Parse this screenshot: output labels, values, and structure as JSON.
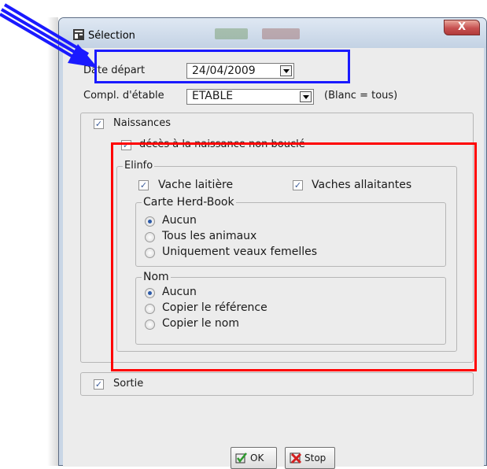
{
  "window": {
    "title": "Sélection",
    "close_glyph": "X"
  },
  "form": {
    "date_label": "Date départ",
    "date_value": "24/04/2009",
    "compl_label": "Compl. d'étable",
    "compl_value": "ETABLE",
    "compl_hint": "(Blanc = tous)"
  },
  "naissances": {
    "label": "Naissances",
    "checked": true,
    "deces_label": "décès à la naissance non bouclé",
    "elinfo": {
      "legend": "Elinfo",
      "vache_laitiere": "Vache laitière",
      "vaches_allaitantes": "Vaches allaitantes",
      "herdbook": {
        "legend": "Carte Herd-Book",
        "options": [
          "Aucun",
          "Tous les animaux",
          "Uniquement veaux femelles"
        ],
        "selected": "Aucun"
      },
      "nom": {
        "legend": "Nom",
        "options": [
          "Aucun",
          "Copier le référence",
          "Copier le nom"
        ],
        "selected": "Aucun"
      }
    }
  },
  "sortie": {
    "label": "Sortie",
    "checked": true
  },
  "buttons": {
    "ok": "OK",
    "stop": "Stop"
  },
  "annotations": {
    "blue_color": "#1a1aff",
    "red_color": "#ff0000"
  },
  "icons": [
    "window-app-icon",
    "close-icon",
    "dropdown-arrow-icon",
    "checkmark-icon",
    "ok-check-icon",
    "stop-x-icon",
    "arrow-pointer-icon"
  ]
}
